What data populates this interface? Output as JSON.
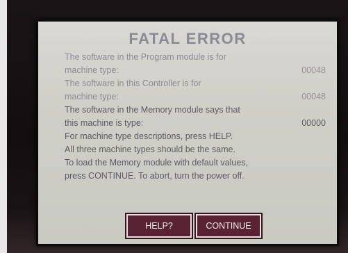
{
  "screen": {
    "title": "FATAL ERROR",
    "lines": [
      "The software in the Program module is for",
      "machine type:",
      "The software in this Controller is for",
      "machine type:",
      "The software in the Memory module says that",
      "this machine is type:",
      "For machine type descriptions, press HELP.",
      "All three machine types should be the same.",
      "To load the Memory module with default values,",
      "press CONTINUE.  To abort, turn the power off."
    ],
    "values": {
      "program_module": "00048",
      "controller": "00048",
      "memory_module": "00000"
    }
  },
  "buttons": {
    "help": "HELP?",
    "continue": "CONTINUE"
  }
}
